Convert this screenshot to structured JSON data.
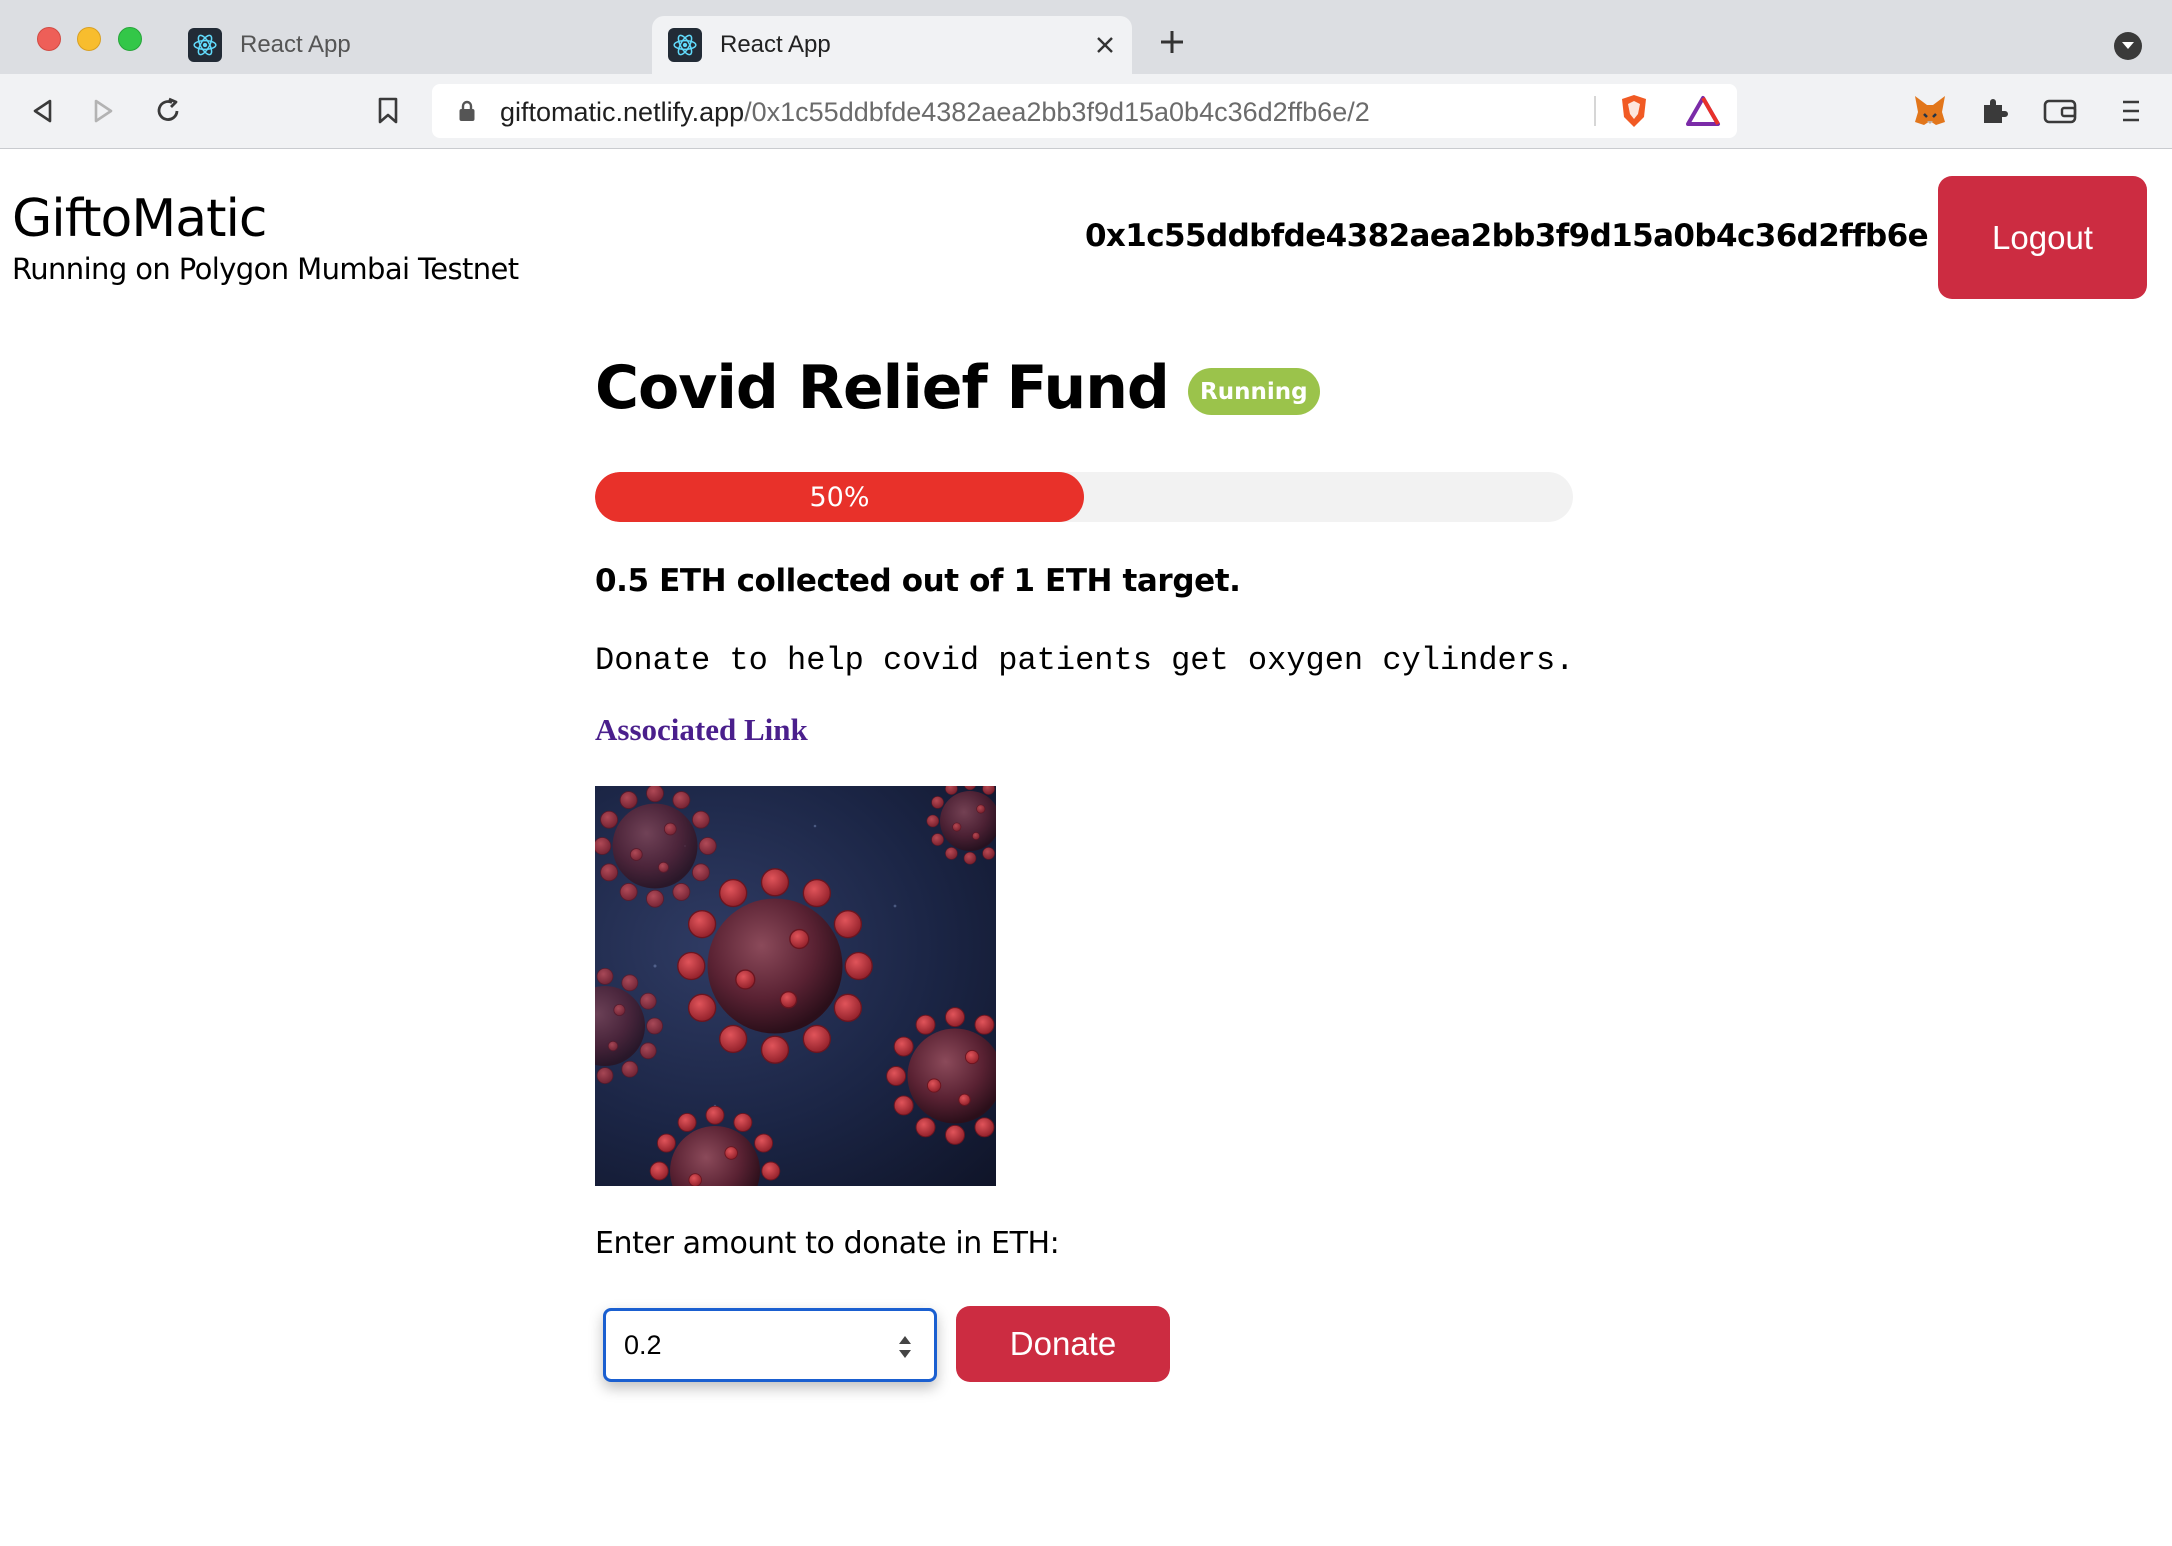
{
  "browser": {
    "tabs": [
      {
        "title": "React App",
        "active": false
      },
      {
        "title": "React App",
        "active": true
      }
    ],
    "url": {
      "host": "giftomatic.netlify.app",
      "path": "/0x1c55ddbfde4382aea2bb3f9d15a0b4c36d2ffb6e/2"
    },
    "icons": [
      "back-icon",
      "forward-icon",
      "reload-icon",
      "bookmark-icon",
      "lock-icon",
      "brave-shields-icon",
      "brave-rewards-icon",
      "metamask-icon",
      "extensions-icon",
      "wallet-icon",
      "menu-icon"
    ]
  },
  "header": {
    "brand": "GiftoMatic",
    "network": "Running on Polygon Mumbai Testnet",
    "wallet_address": "0x1c55ddbfde4382aea2bb3f9d15a0b4c36d2ffb6e",
    "logout_label": "Logout"
  },
  "campaign": {
    "title": "Covid Relief Fund",
    "status": "Running",
    "progress_percent": 50,
    "progress_label": "50%",
    "collected_text": "0.5 ETH collected out of 1 ETH target.",
    "description": "Donate to help covid patients get oxygen cylinders.",
    "link_label": "Associated Link"
  },
  "donate": {
    "label": "Enter amount to donate in ETH:",
    "amount": "0.2",
    "button_label": "Donate"
  },
  "colors": {
    "primary_red": "#cc2c41",
    "progress_fill": "#e8312a",
    "badge_green": "#9bc34b",
    "link_purple": "#4a1f8c",
    "input_focus": "#1a5fd0"
  }
}
